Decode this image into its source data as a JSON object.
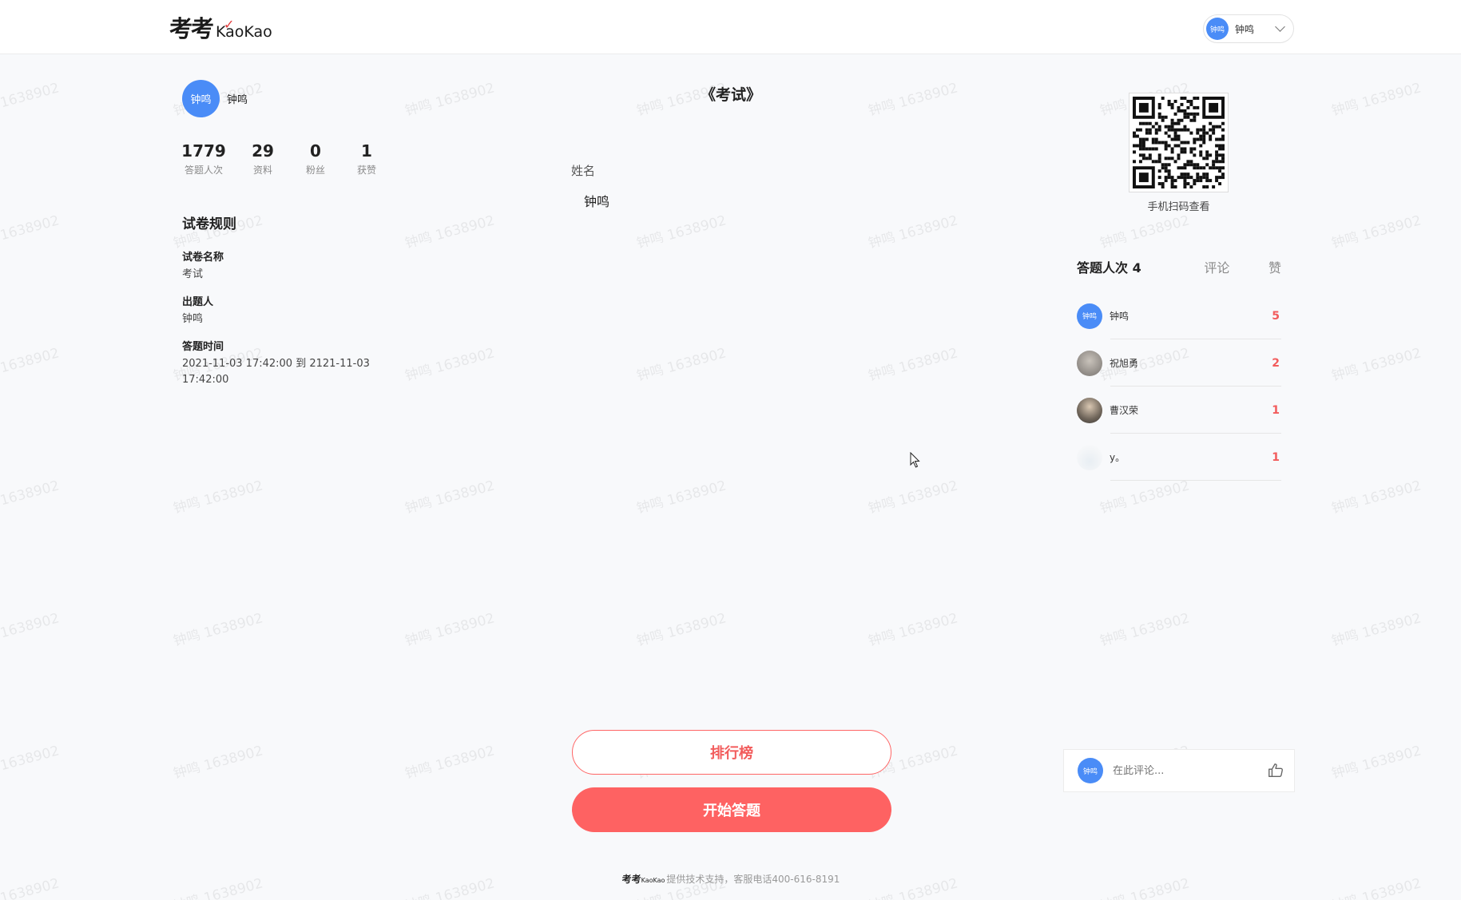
{
  "watermark": {
    "text_a": "钟鸣 1638902",
    "text_b": "钟鸣 1638902"
  },
  "header": {
    "logo_cn": "考考",
    "logo_en": "KaoKao",
    "user": {
      "avatar_text": "钟鸣",
      "name": "钟鸣"
    }
  },
  "profile": {
    "avatar_text": "钟鸣",
    "name": "钟鸣",
    "stats": [
      {
        "num": "1779",
        "label": "答题人次"
      },
      {
        "num": "29",
        "label": "资料"
      },
      {
        "num": "0",
        "label": "粉丝"
      },
      {
        "num": "1",
        "label": "获赞"
      }
    ]
  },
  "rules": {
    "title": "试卷规则",
    "items": [
      {
        "key": "试卷名称",
        "value": "考试"
      },
      {
        "key": "出题人",
        "value": "钟鸣"
      },
      {
        "key": "答题时间",
        "value": "2021-11-03 17:42:00 到 2121-11-03 17:42:00"
      }
    ]
  },
  "exam": {
    "title": "《考试》",
    "field_label": "姓名",
    "field_value": "钟鸣",
    "rank_button": "排行榜",
    "start_button": "开始答题"
  },
  "footer": {
    "logo_cn": "考考",
    "logo_en": "KaoKao",
    "text": "提供技术支持，客服电话400-616-8191"
  },
  "qr": {
    "caption": "手机扫码查看"
  },
  "tabs": [
    {
      "label": "答题人次 4",
      "active": true
    },
    {
      "label": "评论",
      "active": false
    },
    {
      "label": "赞",
      "active": false
    }
  ],
  "ranking": [
    {
      "avatar_text": "钟鸣",
      "name": "钟鸣",
      "score": "5"
    },
    {
      "avatar_text": "",
      "name": "祝旭勇",
      "score": "2"
    },
    {
      "avatar_text": "",
      "name": "曹汉荣",
      "score": "1"
    },
    {
      "avatar_text": "",
      "name": "y。",
      "score": "1"
    }
  ],
  "comment": {
    "avatar_text": "钟鸣",
    "placeholder": "在此评论..."
  },
  "colors": {
    "accent": "#fe6262",
    "avatar_blue": "#4a8cf7"
  }
}
